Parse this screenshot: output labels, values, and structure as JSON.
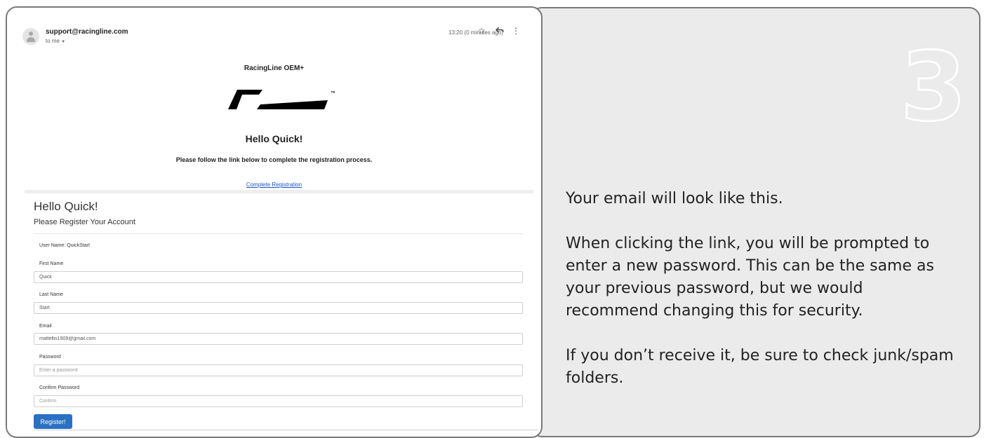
{
  "email_header": {
    "sender": "support@racingline.com",
    "recipient": "to me",
    "timestamp": "13:20 (0 minutes ago)"
  },
  "email_body": {
    "brand": "RacingLine OEM+",
    "logo_mark": "™",
    "greeting": "Hello Quick!",
    "message": "Please follow the link below to complete the registration process.",
    "link_text": "Complete Registration"
  },
  "registration_form": {
    "title": "Hello Quick!",
    "subtitle": "Please Register Your Account",
    "username": "User Name: QuickStart",
    "fields": [
      {
        "label": "First Name",
        "value": "Quick",
        "placeholder": ""
      },
      {
        "label": "Last Name",
        "value": "Start",
        "placeholder": ""
      },
      {
        "label": "Email",
        "value": "mattellis1909@gmail.com",
        "placeholder": ""
      },
      {
        "label": "Password",
        "value": "",
        "placeholder": "Enter a password"
      },
      {
        "label": "Confirm Password",
        "value": "",
        "placeholder": "Confirm"
      }
    ],
    "submit_label": "Register!"
  },
  "step": {
    "number": "3",
    "lines": [
      "Your email will look like this.",
      "When clicking the link, you will be prompted to enter a new password. This can be the same as your previous password, but we would recommend changing this for security.",
      "If you don’t receive it, be sure to check junk/spam folders."
    ]
  },
  "colors": {
    "link": "#1a56c8",
    "button": "#2a70c4",
    "panel_background": "#ebebeb"
  },
  "icons": [
    "avatar-icon",
    "dropdown-caret-icon",
    "star-icon",
    "reply-icon",
    "more-options-icon",
    "racingline-logo"
  ]
}
